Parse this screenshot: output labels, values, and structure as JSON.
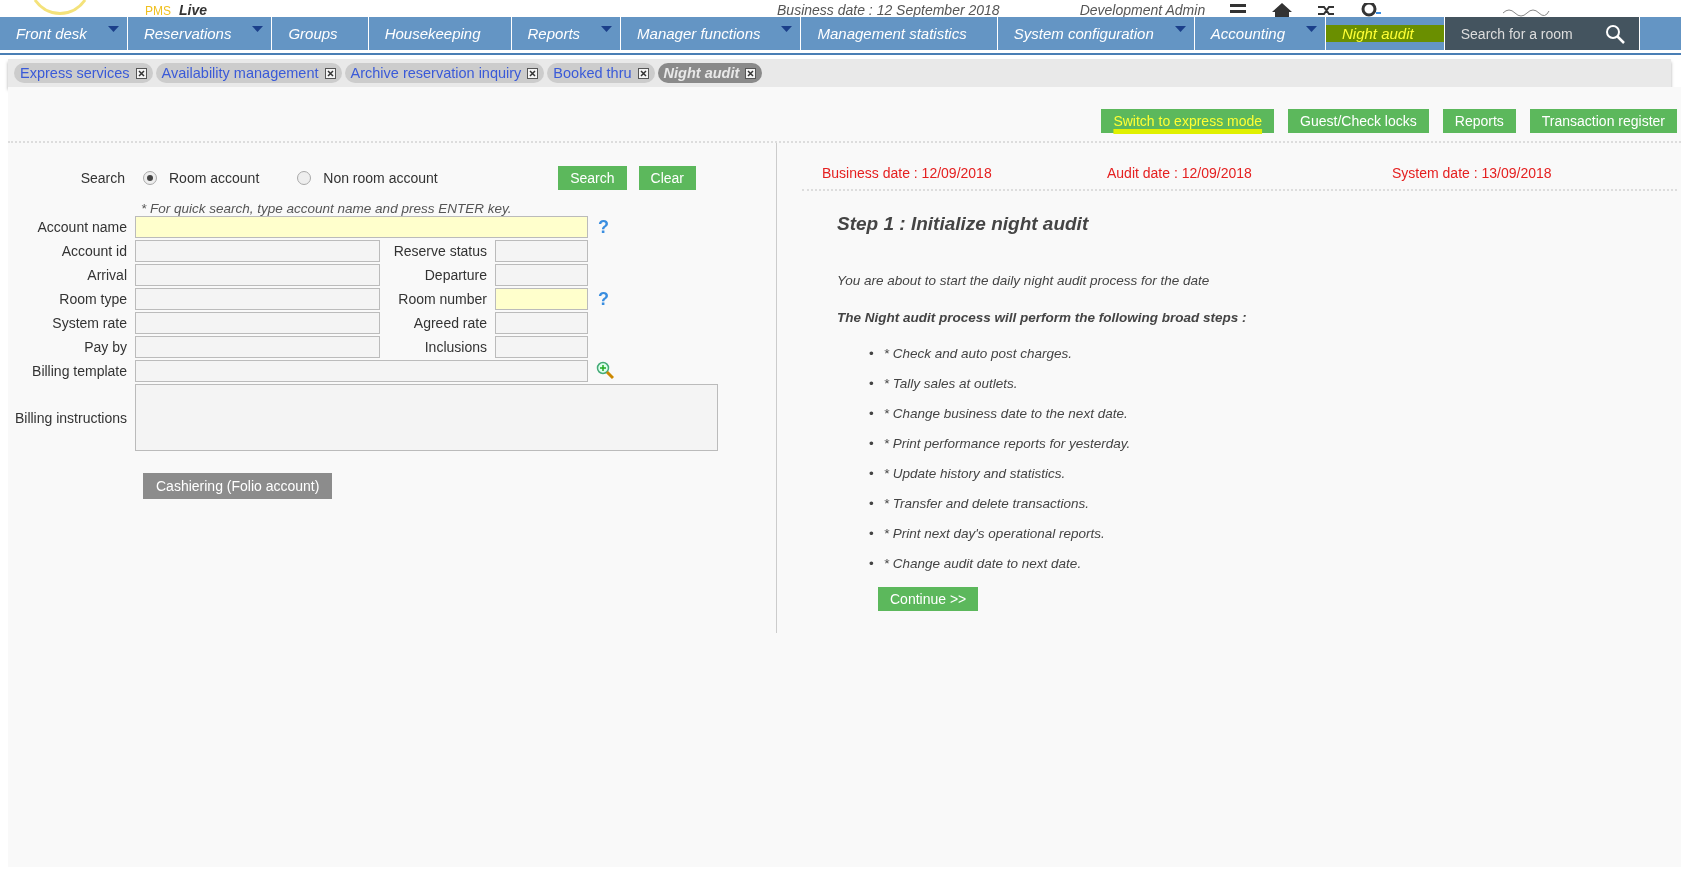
{
  "header": {
    "product": "PMS",
    "environment": "Live",
    "business_date": "Business date : 12 September 2018",
    "user": "Development Admin"
  },
  "nav": {
    "items": [
      {
        "label": "Front desk",
        "dropdown": true,
        "selected": false
      },
      {
        "label": "Reservations",
        "dropdown": true,
        "selected": false
      },
      {
        "label": "Groups",
        "dropdown": false,
        "selected": false
      },
      {
        "label": "Housekeeping",
        "dropdown": false,
        "selected": false
      },
      {
        "label": "Reports",
        "dropdown": true,
        "selected": false
      },
      {
        "label": "Manager functions",
        "dropdown": true,
        "selected": false
      },
      {
        "label": "Management statistics",
        "dropdown": false,
        "selected": false
      },
      {
        "label": "System configuration",
        "dropdown": true,
        "selected": false
      },
      {
        "label": "Accounting",
        "dropdown": true,
        "selected": false
      },
      {
        "label": "Night audit",
        "dropdown": false,
        "selected": true
      }
    ],
    "search": {
      "placeholder": "Search for a room"
    }
  },
  "open_tabs": [
    {
      "label": "Express services",
      "selected": false
    },
    {
      "label": "Availability management",
      "selected": false
    },
    {
      "label": "Archive reservation inquiry",
      "selected": false
    },
    {
      "label": "Booked thru",
      "selected": false
    },
    {
      "label": "Night audit",
      "selected": true
    }
  ],
  "toolbar": [
    {
      "label": "Switch to express mode",
      "highlighted": true
    },
    {
      "label": "Guest/Check locks",
      "highlighted": false
    },
    {
      "label": "Reports",
      "highlighted": false
    },
    {
      "label": "Transaction register",
      "highlighted": false
    }
  ],
  "search_form": {
    "label": "Search",
    "options": [
      {
        "label": "Room account",
        "selected": true
      },
      {
        "label": "Non room account",
        "selected": false
      }
    ],
    "buttons": [
      "Search",
      "Clear"
    ],
    "hint": "* For quick search, type account name and press ENTER key.",
    "rows": [
      {
        "kind": "wide",
        "label": "Account name",
        "highlighted": true,
        "help_mark": "?"
      },
      {
        "kind": "pair",
        "label": "Account id",
        "highlighted": false,
        "label2": "Reserve status",
        "highlighted2": false
      },
      {
        "kind": "pair",
        "label": "Arrival",
        "highlighted": false,
        "label2": "Departure",
        "highlighted2": false
      },
      {
        "kind": "pair",
        "label": "Room type",
        "highlighted": false,
        "label2": "Room number",
        "highlighted2": true,
        "help_mark": "?"
      },
      {
        "kind": "pair",
        "label": "System rate",
        "highlighted": false,
        "label2": "Agreed rate",
        "highlighted2": false
      },
      {
        "kind": "pair",
        "label": "Pay by",
        "highlighted": false,
        "label2": "Inclusions",
        "highlighted2": false
      },
      {
        "kind": "wide",
        "label": "Billing template",
        "highlighted": false,
        "lookup": true
      },
      {
        "kind": "area",
        "label": "Billing instructions",
        "highlighted": false
      }
    ],
    "cashiering": {
      "label": "Cashiering (Folio account)",
      "disabled": true
    }
  },
  "audit": {
    "dates": [
      "Business date : 12/09/2018",
      "Audit date : 12/09/2018",
      "System date : 13/09/2018"
    ],
    "title": "Step 1 : Initialize night audit",
    "intro": "You are about to start the daily night audit process for the date",
    "steps_heading": "The Night audit process will perform the following broad steps :",
    "steps": [
      {
        "bullet": "•",
        "text": "* Check and auto post charges."
      },
      {
        "bullet": "•",
        "text": "* Tally sales at outlets."
      },
      {
        "bullet": "•",
        "text": "* Change business date to the next date."
      },
      {
        "bullet": "•",
        "text": "* Print performance reports for yesterday."
      },
      {
        "bullet": "•",
        "text": "* Update history and statistics."
      },
      {
        "bullet": "•",
        "text": "* Transfer and delete transactions."
      },
      {
        "bullet": "•",
        "text": "* Print next day's operational reports."
      },
      {
        "bullet": "•",
        "text": "* Change audit date to next date."
      }
    ],
    "continue": "Continue >>"
  }
}
